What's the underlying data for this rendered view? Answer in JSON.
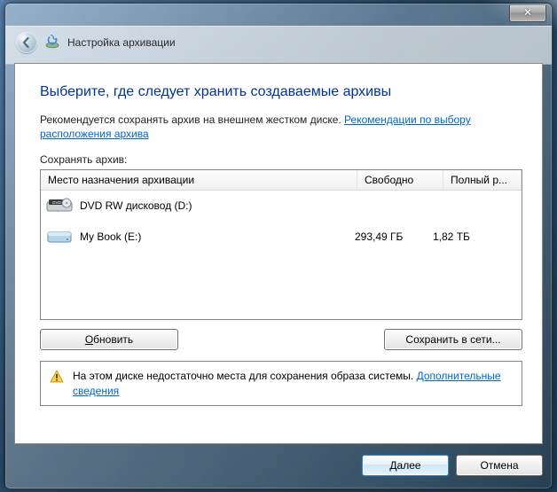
{
  "titlebar": {
    "close_label": "✕"
  },
  "header": {
    "wizard_title": "Настройка архивации"
  },
  "main": {
    "heading": "Выберите, где следует хранить создаваемые архивы",
    "recommend_prefix": "Рекомендуется сохранять архив на внешнем жестком диске. ",
    "recommend_link": "Рекомендации по выбору расположения архива",
    "save_label": "Сохранять архив:"
  },
  "table": {
    "columns": {
      "destination": "Место назначения архивации",
      "free": "Свободно",
      "full": "Полный р..."
    },
    "rows": [
      {
        "name": "DVD RW дисковод (D:)",
        "free": "",
        "full": "",
        "icon": "dvd"
      },
      {
        "name": "My Book (E:)",
        "free": "293,49 ГБ",
        "full": "1,82 ТБ",
        "icon": "hdd"
      }
    ]
  },
  "buttons": {
    "refresh": "Обновить",
    "save_network": "Сохранить в сети..."
  },
  "info": {
    "text": "На этом диске недостаточно места для сохранения образа системы. ",
    "link": "Дополнительные сведения"
  },
  "footer": {
    "next": "Далее",
    "cancel": "Отмена"
  }
}
